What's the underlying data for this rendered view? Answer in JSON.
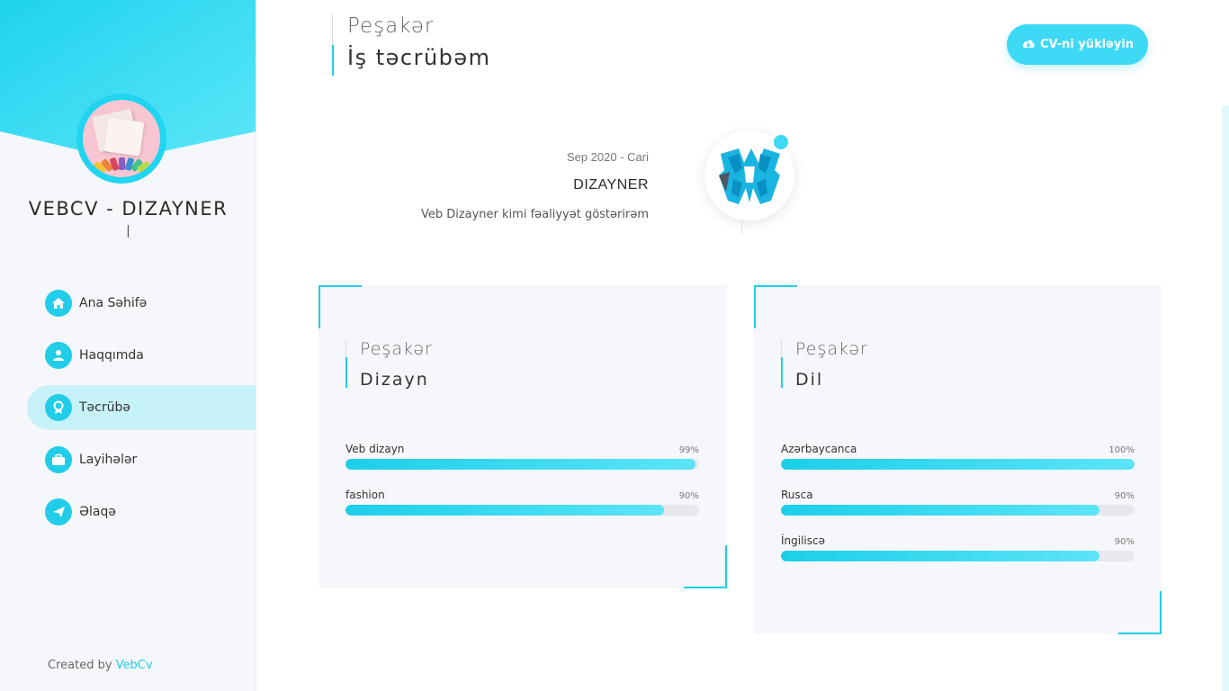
{
  "sidebar": {
    "brand_name": "VEBCV - DIZAYNER",
    "brand_cursor": "|",
    "nav": [
      {
        "label": "Ana Səhifə",
        "icon": "home-icon",
        "active": false
      },
      {
        "label": "Haqqımda",
        "icon": "user-icon",
        "active": false
      },
      {
        "label": "Təcrübə",
        "icon": "award-icon",
        "active": true
      },
      {
        "label": "Layihələr",
        "icon": "briefcase-icon",
        "active": false
      },
      {
        "label": "Əlaqə",
        "icon": "paper-plane-icon",
        "active": false
      }
    ],
    "footer_prefix": "Created by",
    "footer_link": "VebCv"
  },
  "header": {
    "subtitle": "Peşakər",
    "title": "İş təcrübəm",
    "cv_button": "CV-ni yükləyin",
    "cv_icon": "cloud-download-icon"
  },
  "timeline": {
    "date": "Sep 2020 - Cari",
    "role": "DIZAYNER",
    "description": "Veb Dizayner kimi fəaliyyət göstərirəm",
    "logo_icon": "company-logo-icon"
  },
  "skills": {
    "design": {
      "subtitle": "Peşakər",
      "title": "Dizayn",
      "items": [
        {
          "name": "Veb dizayn",
          "percent_label": "99%",
          "value": 99
        },
        {
          "name": "fashion",
          "percent_label": "90%",
          "value": 90
        }
      ]
    },
    "language": {
      "subtitle": "Peşakər",
      "title": "Dil",
      "items": [
        {
          "name": "Azərbaycanca",
          "percent_label": "100%",
          "value": 100
        },
        {
          "name": "Rusca",
          "percent_label": "90%",
          "value": 90
        },
        {
          "name": "İngiliscə",
          "percent_label": "90%",
          "value": 90
        }
      ]
    }
  },
  "colors": {
    "accent": "#21cde8",
    "sidebar_bg": "#f5f7fb",
    "active_nav_bg": "#c8f2f9"
  }
}
